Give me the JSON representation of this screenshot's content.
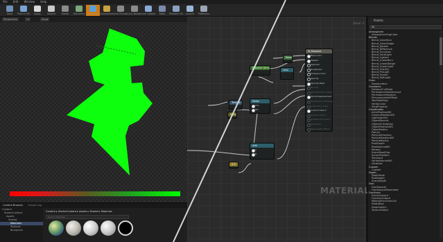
{
  "menu": {
    "items": [
      "File",
      "Edit",
      "Window",
      "Help"
    ]
  },
  "toolbar": {
    "buttons": [
      {
        "label": "Save",
        "color": "#6f8fb5"
      },
      {
        "label": "Find in CB",
        "color": "#7aa2d6"
      },
      {
        "label": "Apply",
        "color": "#d9d9d9"
      },
      {
        "label": "Search",
        "color": "#c9c9c9"
      },
      {
        "label": "Home",
        "color": "#8a8a8a"
      },
      {
        "label": "Hierarchy",
        "color": "#7da57d"
      },
      {
        "label": "Clean Up",
        "color": "#5aa0d8"
      },
      {
        "label": "Connectors",
        "color": "#caa040"
      },
      {
        "label": "Live Preview",
        "color": "#8a8a8a"
      },
      {
        "label": "Live Nodes",
        "color": "#8a8a8a"
      },
      {
        "label": "Live Update",
        "color": "#8aaad6"
      },
      {
        "label": "Stats",
        "color": "#7a8aaa"
      },
      {
        "label": "Platform Stats",
        "color": "#8aa0c0"
      },
      {
        "label": "Launch",
        "color": "#9ab6d8"
      },
      {
        "label": "Platforms",
        "color": "#9aa6b6"
      }
    ]
  },
  "viewport": {
    "tabs": [
      "Perspective",
      "Lit",
      "Show"
    ]
  },
  "graph": {
    "watermark": "MATERIAL",
    "zoom": "Zoom -1",
    "nodes": {
      "result": {
        "title": "M_Dissolve",
        "pins": [
          "Base Color",
          "Metallic",
          "Specular",
          "Roughness",
          "Emissive Color",
          "Opacity",
          "Opacity Mask",
          "Normal",
          "World Position Offset",
          "World Displacement",
          "Tessellation Multiplier",
          "Subsurface Color",
          "Custom Data 0",
          "Custom Data 1",
          "Ambient Occlusion",
          "Refraction",
          "Pixel Depth Offset"
        ]
      },
      "green": {
        "title": "Param"
      },
      "param": {
        "title": "Dissolve Amount"
      },
      "lerp": {
        "title": "Lerp",
        "pins": [
          "A",
          "B",
          "Alpha"
        ]
      },
      "tex1": {
        "title": "Texture",
        "pins": [
          "UVs",
          "Tex"
        ]
      },
      "tex2": {
        "title": "Noise",
        "pins": [
          "UVs",
          "Tex"
        ]
      },
      "step": {
        "title": "Step",
        "pins": [
          "Y",
          "X"
        ]
      },
      "add": {
        "title": "Add",
        "pins": [
          "A",
          "B"
        ]
      },
      "const": {
        "title": "0.5"
      },
      "sub": {
        "title": "Subtract"
      }
    }
  },
  "palette": {
    "title": "Palette",
    "category": "All",
    "items": [
      {
        "t": "Atmosphere",
        "c": true
      },
      {
        "t": "AtmosphericFogColor"
      },
      {
        "t": "Blends",
        "c": true
      },
      {
        "t": "Blend_ColorBurn"
      },
      {
        "t": "Blend_ColorDodge"
      },
      {
        "t": "Blend_Darken"
      },
      {
        "t": "Blend_Difference"
      },
      {
        "t": "Blend_Exclusion"
      },
      {
        "t": "Blend_HardLight"
      },
      {
        "t": "Blend_Lighten"
      },
      {
        "t": "Blend_LinearBurn"
      },
      {
        "t": "Blend_LinearDodge"
      },
      {
        "t": "Blend_LinearLight"
      },
      {
        "t": "Blend_Overlay"
      },
      {
        "t": "Blend_PinLight"
      },
      {
        "t": "Blend_Screen"
      },
      {
        "t": "Blend_SoftLight"
      },
      {
        "t": "Color",
        "c": true
      },
      {
        "t": "Desaturation"
      },
      {
        "t": "Constants",
        "c": true
      },
      {
        "t": "DistanceCullFade"
      },
      {
        "t": "PerInstanceFadeAmount"
      },
      {
        "t": "PerInstanceRandom"
      },
      {
        "t": "PrecomputedAOMask"
      },
      {
        "t": "TwoSidedSign"
      },
      {
        "t": "VertexColor"
      },
      {
        "t": "ViewProperty"
      },
      {
        "t": "Coordinates",
        "c": true
      },
      {
        "t": "ActorPositionWS"
      },
      {
        "t": "CameraPositionWS"
      },
      {
        "t": "LightmapUVs"
      },
      {
        "t": "ObjectBounds"
      },
      {
        "t": "ObjectOrientation"
      },
      {
        "t": "ObjectPositionWS"
      },
      {
        "t": "ObjectRadius"
      },
      {
        "t": "Panner"
      },
      {
        "t": "ParticleDirection"
      },
      {
        "t": "ParticlePositionWS"
      },
      {
        "t": "ParticleRadius"
      },
      {
        "t": "PixelDepth"
      },
      {
        "t": "PixelNormalWS"
      },
      {
        "t": "Rotator"
      },
      {
        "t": "SceneTexelSize"
      },
      {
        "t": "ScreenPosition"
      },
      {
        "t": "TexCoord"
      },
      {
        "t": "VertexNormalWS"
      },
      {
        "t": "ViewSize"
      },
      {
        "t": "Custom",
        "c": true
      },
      {
        "t": "Custom"
      },
      {
        "t": "Depth",
        "c": true
      },
      {
        "t": "DepthFade"
      },
      {
        "t": "PixelDepth"
      },
      {
        "t": "SceneDepth"
      },
      {
        "t": "Font",
        "c": true
      },
      {
        "t": "FontSample"
      },
      {
        "t": "FontSampleParameter"
      },
      {
        "t": "Functions",
        "c": true
      },
      {
        "t": "FunctionInput"
      },
      {
        "t": "FunctionOutput"
      },
      {
        "t": "MaterialFunctionCall"
      },
      {
        "t": "StaticBool"
      },
      {
        "t": "StaticSwitch"
      },
      {
        "t": "TextureObject"
      }
    ]
  },
  "content_browser": {
    "tabs": [
      "Content Browser",
      "Output Log"
    ],
    "buttons": [
      "Add New",
      "Save All"
    ],
    "path": [
      "Content",
      "StarterContent",
      "Assets",
      "Shared",
      "Materials"
    ],
    "search_placeholder": "Search Materials",
    "tree": [
      "Content",
      "StarterContent",
      "Assets",
      "Shared",
      "Materials",
      "Textures",
      "Blueprints"
    ]
  }
}
